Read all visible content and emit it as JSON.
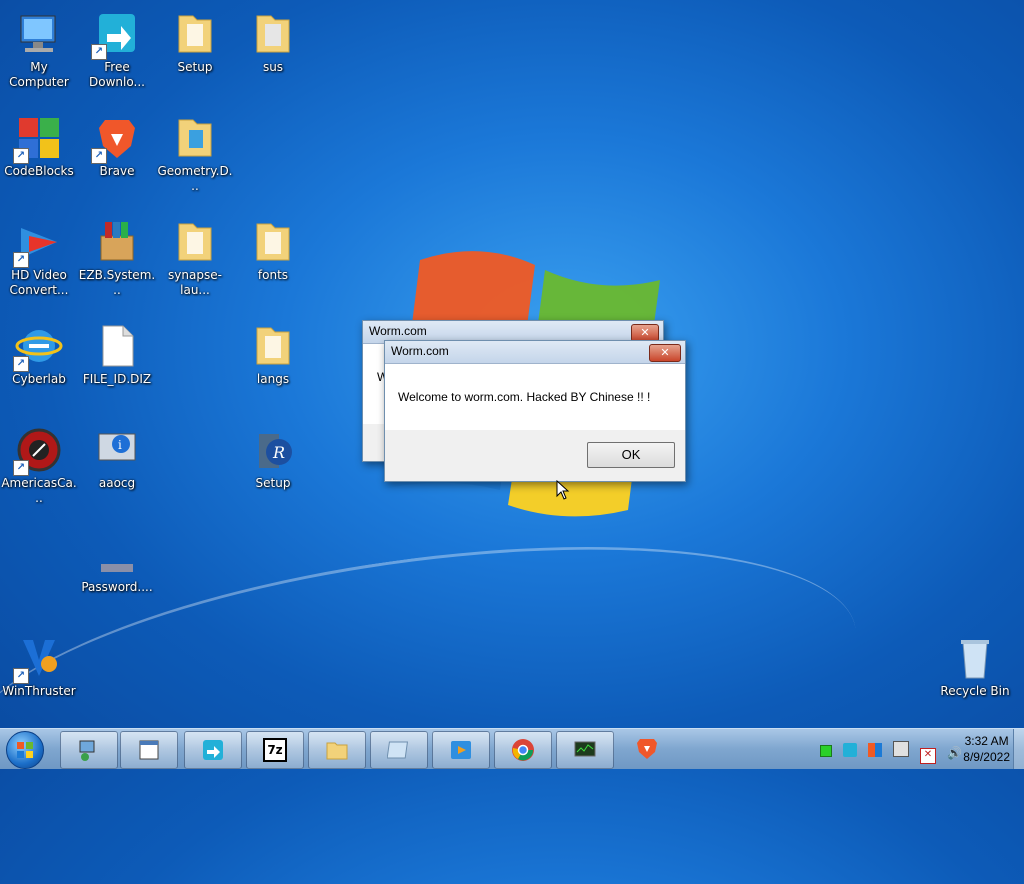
{
  "desktop": {
    "icons": [
      {
        "label": "My Computer",
        "icon": "computer-icon"
      },
      {
        "label": "Free Downlo...",
        "icon": "download-manager-icon"
      },
      {
        "label": "Setup",
        "icon": "folder-icon"
      },
      {
        "label": "sus",
        "icon": "folder-icon"
      },
      {
        "label": "CodeBlocks",
        "icon": "codeblocks-icon"
      },
      {
        "label": "Brave",
        "icon": "brave-lion-icon"
      },
      {
        "label": "Geometry.D...",
        "icon": "folder-icon"
      },
      {
        "label": "HD Video Convert...",
        "icon": "video-converter-icon"
      },
      {
        "label": "EZB.System...",
        "icon": "winrar-box-icon"
      },
      {
        "label": "synapse-lau...",
        "icon": "folder-icon"
      },
      {
        "label": "fonts",
        "icon": "folder-icon"
      },
      {
        "label": "Cyberlab",
        "icon": "internet-explorer-icon"
      },
      {
        "label": "FILE_ID.DIZ",
        "icon": "blank-file-icon"
      },
      {
        "label": "langs",
        "icon": "folder-icon"
      },
      {
        "label": "AmericasCa...",
        "icon": "casino-chip-icon"
      },
      {
        "label": "aaocg",
        "icon": "info-monitor-icon"
      },
      {
        "label": "Setup",
        "icon": "setup-r-icon"
      },
      {
        "label": "Password....",
        "icon": "password-file-icon"
      },
      {
        "label": "WinThruster",
        "icon": "winthruster-icon"
      },
      {
        "label": "Recycle Bin",
        "icon": "recycle-bin-icon"
      }
    ]
  },
  "dialog_back": {
    "title": "Worm.com",
    "partial_text": "W",
    "close_label": "✕"
  },
  "dialog_front": {
    "title": "Worm.com",
    "message": "Welcome to worm.com. Hacked BY Chinese !! !",
    "ok_label": "OK",
    "close_label": "✕"
  },
  "taskbar": {
    "buttons": [
      {
        "icon": "network-computer-icon"
      },
      {
        "icon": "notepad-window-icon"
      },
      {
        "icon": "download-manager-icon"
      },
      {
        "icon": "7zip-icon",
        "text": "7z"
      },
      {
        "icon": "file-explorer-icon"
      },
      {
        "icon": "blank-window-icon"
      },
      {
        "icon": "media-player-icon"
      },
      {
        "icon": "chrome-icon"
      },
      {
        "icon": "task-manager-icon"
      },
      {
        "icon": "brave-lion-icon"
      }
    ],
    "clock_time": "3:32 AM",
    "clock_date": "8/9/2022"
  },
  "colors": {
    "desktop_blue": "#1b78d8",
    "titlebar": "#c4d5ea",
    "close_red": "#c9452b"
  }
}
